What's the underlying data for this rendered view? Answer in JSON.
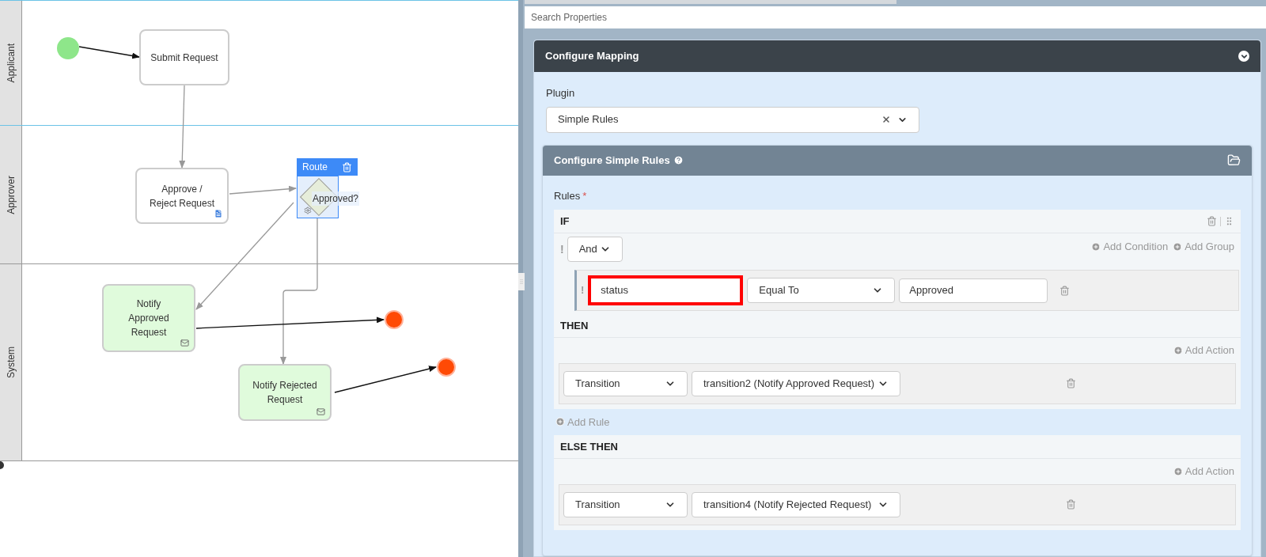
{
  "lanes": [
    {
      "label": "Applicant"
    },
    {
      "label": "Approver"
    },
    {
      "label": "System"
    }
  ],
  "nodes": [
    {
      "kind": "start"
    },
    {
      "kind": "task",
      "label": "Submit Request"
    },
    {
      "kind": "user_task",
      "label": "Approve /\nReject Request"
    },
    {
      "kind": "gateway",
      "label": "Approved?",
      "toolbar_label": "Route",
      "selected": true
    },
    {
      "kind": "send_task",
      "label": "Notify\nApproved\nRequest"
    },
    {
      "kind": "send_task",
      "label": "Notify Rejected\nRequest"
    },
    {
      "kind": "end"
    },
    {
      "kind": "end"
    }
  ],
  "search": {
    "placeholder": "Search Properties"
  },
  "mapping": {
    "title": "Configure Mapping",
    "plugin_label": "Plugin",
    "plugin_value": "Simple Rules"
  },
  "rules_panel": {
    "title": "Configure Simple Rules",
    "rules_label": "Rules",
    "required_mark": "*",
    "if": {
      "title": "IF",
      "not_toggle": "!",
      "operator": "And",
      "add_condition": "Add Condition",
      "add_group": "Add Group",
      "conditions": [
        {
          "not_toggle": "!",
          "field": "status",
          "highlighted": true,
          "comparator": "Equal To",
          "value": "Approved"
        }
      ]
    },
    "then": {
      "title": "THEN",
      "add_action": "Add Action",
      "actions": [
        {
          "type": "Transition",
          "target": "transition2 (Notify Approved Request)"
        }
      ]
    },
    "add_rule": "Add Rule",
    "else": {
      "title": "ELSE THEN",
      "add_action": "Add Action",
      "actions": [
        {
          "type": "Transition",
          "target": "transition4 (Notify Rejected Request)"
        }
      ]
    }
  }
}
